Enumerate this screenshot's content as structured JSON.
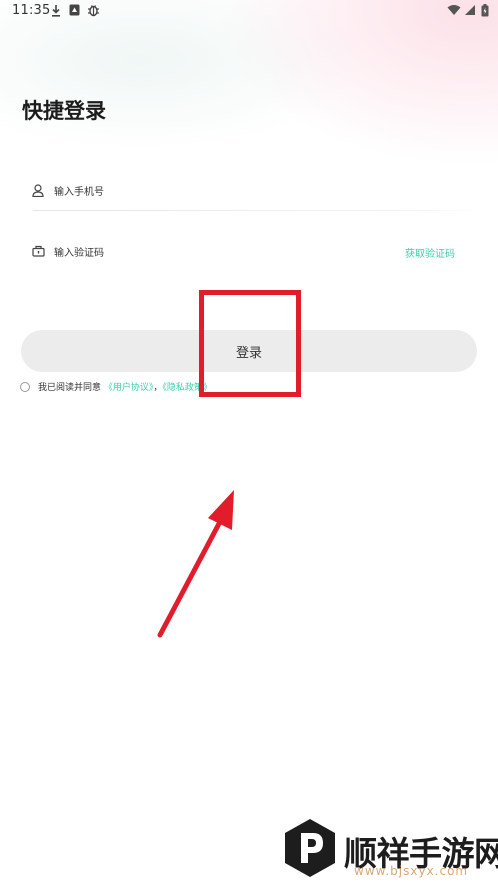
{
  "status_bar": {
    "time": "11:35",
    "icons": [
      "download-icon",
      "sim-icon",
      "bug-icon",
      "wifi-icon",
      "signal-icon",
      "battery-icon"
    ]
  },
  "page": {
    "title": "快捷登录"
  },
  "form": {
    "phone_placeholder": "输入手机号",
    "code_placeholder": "输入验证码",
    "get_code_label": "获取验证码",
    "login_label": "登录"
  },
  "agreement": {
    "prefix": "我已阅读并同意",
    "user_agreement": "《用户协议》",
    "separator": "，",
    "privacy_policy": "《隐私政策》",
    "agreed": false
  },
  "annotation": {
    "highlight_color": "#e11d2c"
  },
  "watermark": {
    "brand": "顺祥手游网",
    "url": "www.bjsxyx.com"
  },
  "colors": {
    "accent": "#3ccfae",
    "button_bg": "#ececec",
    "text": "#1c1c1c"
  }
}
